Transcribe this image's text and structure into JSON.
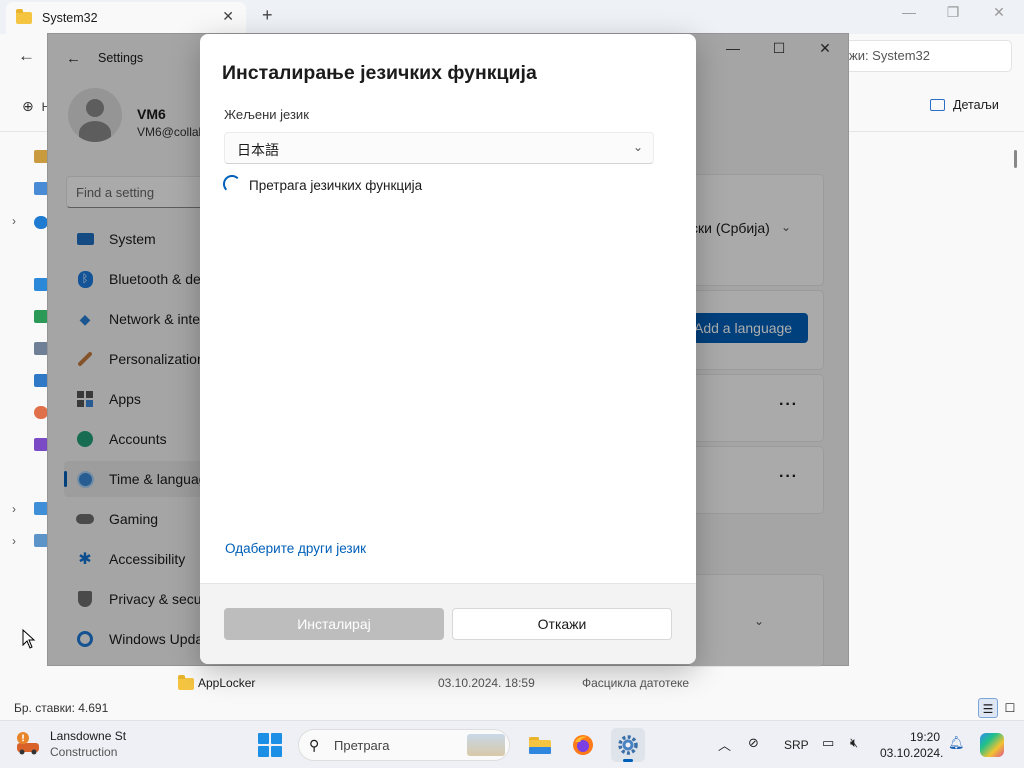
{
  "explorer": {
    "tab_title": "System32",
    "tab_close": "✕",
    "new_tab": "+",
    "minimize": "—",
    "restore": "❐",
    "close": "✕",
    "back": "←",
    "search_text": "жи: System32",
    "new_button": "⊕",
    "new_button_letter": "Н",
    "details_label": "Детаљи",
    "row": {
      "name": "AppLocker",
      "date": "03.10.2024. 18:59",
      "type": "Фасцикла датотеке"
    },
    "status": "Бр. ставки: 4.691"
  },
  "settings": {
    "back": "←",
    "title": "Settings",
    "minimize": "—",
    "maximize": "☐",
    "close": "✕",
    "user_name": "VM6",
    "user_email": "VM6@collab",
    "search_placeholder": "Find a setting",
    "nav": [
      {
        "label": "System",
        "icon": "monitor-icon"
      },
      {
        "label": "Bluetooth & de",
        "icon": "bluetooth-icon"
      },
      {
        "label": "Network & inte",
        "icon": "wifi-icon"
      },
      {
        "label": "Personalization",
        "icon": "brush-icon"
      },
      {
        "label": "Apps",
        "icon": "apps-icon"
      },
      {
        "label": "Accounts",
        "icon": "person-icon"
      },
      {
        "label": "Time & languag",
        "icon": "globe-clock-icon",
        "active": true
      },
      {
        "label": "Gaming",
        "icon": "gamepad-icon"
      },
      {
        "label": "Accessibility",
        "icon": "accessibility-icon"
      },
      {
        "label": "Privacy & secur",
        "icon": "shield-icon"
      },
      {
        "label": "Windows Upda",
        "icon": "update-icon"
      }
    ],
    "region_dropdown": "ски (Србија)",
    "add_language": "Add a language",
    "more": "···"
  },
  "dialog": {
    "title": "Инсталирање језичких функција",
    "language_label": "Жељени језик",
    "language_value": "日本語",
    "chevron": "⌄",
    "progress_text": "Претрага језичких функција",
    "other_language_link": "Одаберите други језик",
    "install_button": "Инсталирај",
    "cancel_button": "Откажи"
  },
  "taskbar": {
    "weather_title": "Lansdowne St",
    "weather_subtitle": "Construction",
    "search_placeholder": "Претрага",
    "language": "SRP",
    "time": "19:20",
    "date": "03.10.2024."
  },
  "colors": {
    "accent": "#005fb8",
    "overlay": "rgba(0,0,0,0.32)",
    "disabled_button": "#bdbdbd"
  }
}
